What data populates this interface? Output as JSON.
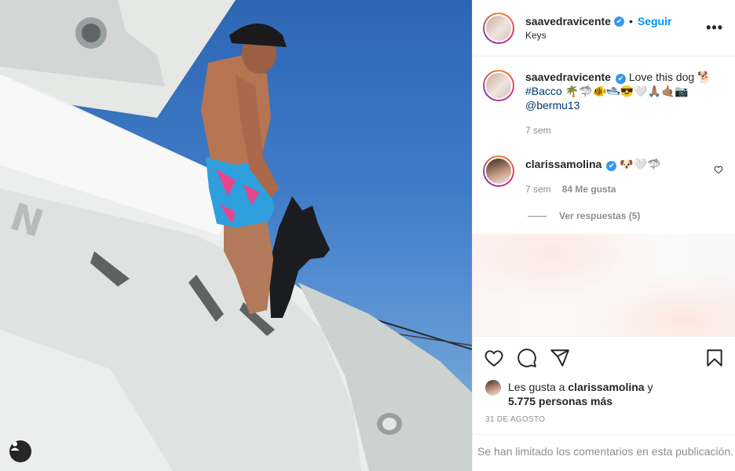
{
  "post_author": {
    "username": "saavedravicente",
    "follow_label": "Seguir",
    "separator": "•",
    "location": "Keys",
    "more_label": "•••"
  },
  "caption": {
    "username": "saavedravicente",
    "text_line1": "Love this dog 🐕",
    "text_line2": "#Bacco 🌴🦈🐠🛥😎🤍🙏🏽🤙🏽📷",
    "mention": "@bermu13",
    "time": "7 sem"
  },
  "comment": {
    "username": "clarissamolina",
    "text": "🐶🤍🦈",
    "time": "7 sem",
    "likes": "84 Me gusta",
    "replies_label": "Ver respuestas (5)"
  },
  "likes_summary": {
    "prefix": "Les gusta a",
    "user": "clarissamolina",
    "conj": "y",
    "others": "5.775 personas más"
  },
  "date": "31 DE AGOSTO",
  "comments_limited": "Se han limitado los comentarios en esta publicación.",
  "icons": {
    "like": "heart-icon",
    "comment": "comment-icon",
    "share": "send-icon",
    "save": "bookmark-icon",
    "user_tags": "user-tag-icon",
    "verified": "verified-badge-icon"
  },
  "colors": {
    "link": "#0095f6",
    "verified": "#3897f0",
    "muted": "#8e8e8e"
  }
}
